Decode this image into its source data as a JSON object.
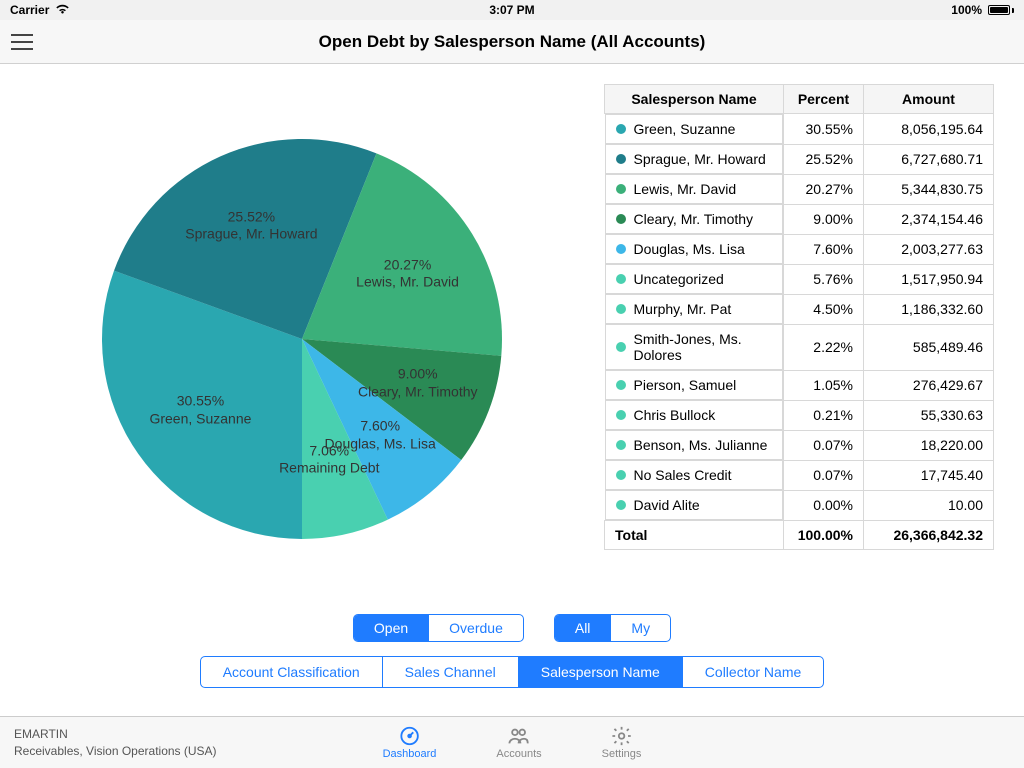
{
  "status": {
    "carrier": "Carrier",
    "time": "3:07 PM",
    "battery": "100%"
  },
  "header": {
    "title": "Open Debt by Salesperson Name (All Accounts)"
  },
  "table": {
    "headers": {
      "name": "Salesperson Name",
      "percent": "Percent",
      "amount": "Amount"
    },
    "rows": [
      {
        "name": "Green, Suzanne",
        "percent": "30.55%",
        "amount": "8,056,195.64",
        "color": "#2aa7b0"
      },
      {
        "name": "Sprague, Mr. Howard",
        "percent": "25.52%",
        "amount": "6,727,680.71",
        "color": "#1f7d8a"
      },
      {
        "name": "Lewis, Mr. David",
        "percent": "20.27%",
        "amount": "5,344,830.75",
        "color": "#3bb07a"
      },
      {
        "name": "Cleary, Mr. Timothy",
        "percent": "9.00%",
        "amount": "2,374,154.46",
        "color": "#2a8a55"
      },
      {
        "name": "Douglas, Ms. Lisa",
        "percent": "7.60%",
        "amount": "2,003,277.63",
        "color": "#3db7e8"
      },
      {
        "name": "Uncategorized",
        "percent": "5.76%",
        "amount": "1,517,950.94",
        "color": "#49d0b0"
      },
      {
        "name": "Murphy, Mr. Pat",
        "percent": "4.50%",
        "amount": "1,186,332.60",
        "color": "#49d0b0"
      },
      {
        "name": "Smith-Jones, Ms. Dolores",
        "percent": "2.22%",
        "amount": "585,489.46",
        "color": "#49d0b0"
      },
      {
        "name": "Pierson, Samuel",
        "percent": "1.05%",
        "amount": "276,429.67",
        "color": "#49d0b0"
      },
      {
        "name": "Chris Bullock",
        "percent": "0.21%",
        "amount": "55,330.63",
        "color": "#49d0b0"
      },
      {
        "name": "Benson, Ms. Julianne",
        "percent": "0.07%",
        "amount": "18,220.00",
        "color": "#49d0b0"
      },
      {
        "name": "No Sales Credit",
        "percent": "0.07%",
        "amount": "17,745.40",
        "color": "#49d0b0"
      },
      {
        "name": "David Alite",
        "percent": "0.00%",
        "amount": "10.00",
        "color": "#49d0b0"
      }
    ],
    "total": {
      "label": "Total",
      "percent": "100.00%",
      "amount": "26,366,842.32"
    }
  },
  "chart_data": {
    "type": "pie",
    "title": "Open Debt by Salesperson Name (All Accounts)",
    "slices": [
      {
        "label": "Green, Suzanne",
        "value": 30.55,
        "color": "#2aa7b0"
      },
      {
        "label": "Sprague, Mr. Howard",
        "value": 25.52,
        "color": "#1f7d8a"
      },
      {
        "label": "Lewis, Mr. David",
        "value": 20.27,
        "color": "#3bb07a"
      },
      {
        "label": "Cleary, Mr. Timothy",
        "value": 9.0,
        "color": "#2a8a55"
      },
      {
        "label": "Douglas, Ms. Lisa",
        "value": 7.6,
        "color": "#3db7e8"
      },
      {
        "label": "Remaining Debt",
        "value": 7.06,
        "color": "#49d0b0"
      }
    ]
  },
  "segments": {
    "status": {
      "options": [
        "Open",
        "Overdue"
      ],
      "selected": 0
    },
    "scope": {
      "options": [
        "All",
        "My"
      ],
      "selected": 0
    },
    "dimension": {
      "options": [
        "Account Classification",
        "Sales Channel",
        "Salesperson Name",
        "Collector Name"
      ],
      "selected": 2
    }
  },
  "footer": {
    "user": "EMARTIN",
    "org": "Receivables, Vision Operations (USA)",
    "tabs": [
      {
        "label": "Dashboard",
        "active": true
      },
      {
        "label": "Accounts",
        "active": false
      },
      {
        "label": "Settings",
        "active": false
      }
    ]
  }
}
